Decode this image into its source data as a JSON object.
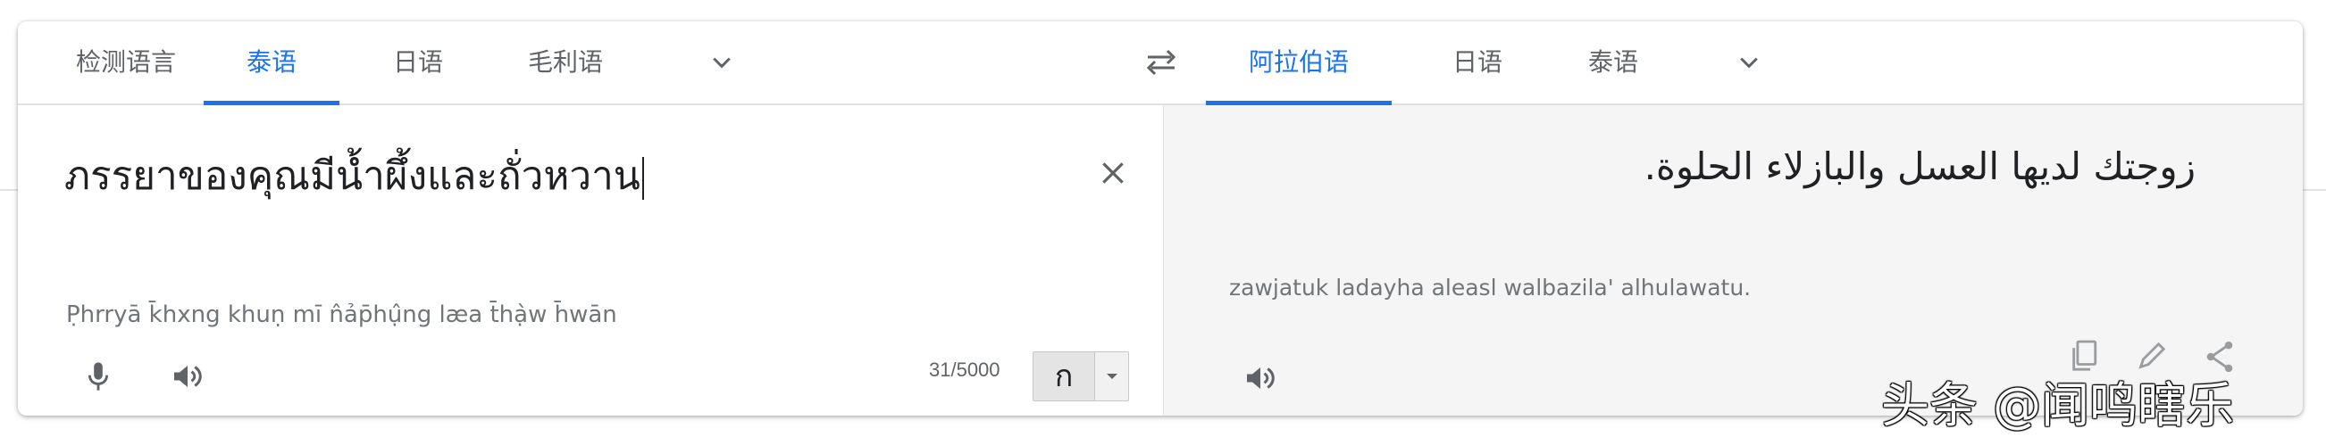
{
  "source_langs": {
    "detect": "检测语言",
    "thai": "泰语",
    "japanese": "日语",
    "maori": "毛利语"
  },
  "target_langs": {
    "arabic": "阿拉伯语",
    "japanese": "日语",
    "thai": "泰语"
  },
  "source": {
    "text": "ภรรยาของคุณมีน้ำผึ้งและถั่วหวาน",
    "transliteration": "P̣hrryā k̄hxng khuṇ mī n̂ảp̄hụ̂ng læa t̄hạ̀w h̄wān",
    "char_count": "31/5000",
    "ime_glyph": "ก"
  },
  "target": {
    "text": "زوجتك لديها العسل والبازلاء الحلوة.",
    "transliteration": "zawjatuk ladayha aleasl walbazila' alhulawatu."
  },
  "watermark": "头条 @闻鸣瞎乐",
  "colors": {
    "accent": "#1a73e8",
    "text": "#202124",
    "muted": "#5f6368",
    "target_bg": "#f5f5f5"
  }
}
